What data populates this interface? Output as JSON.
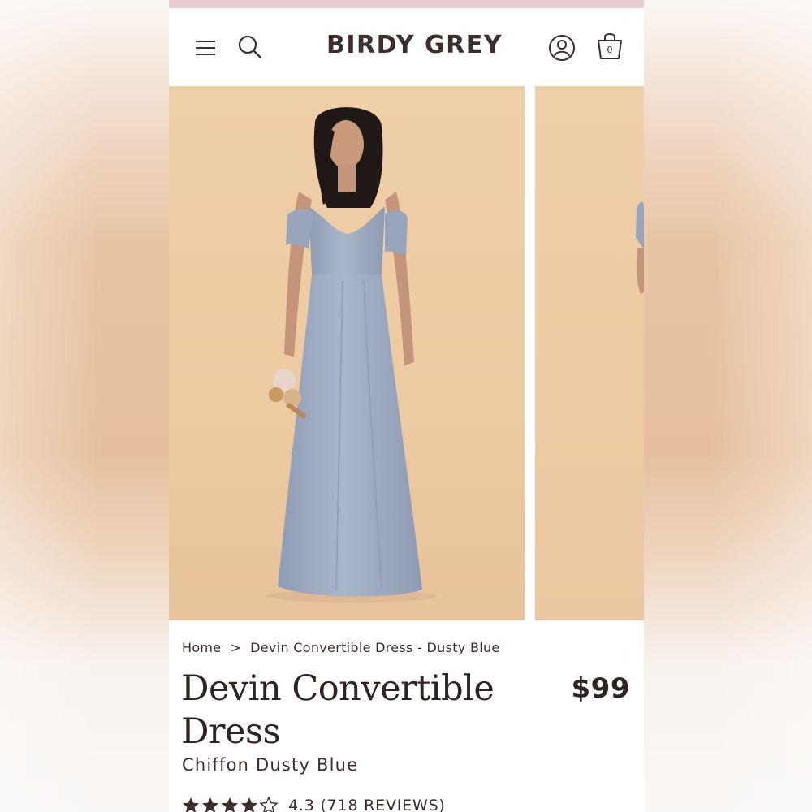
{
  "header": {
    "logo": "BIRDY GREY",
    "cart_count": "0",
    "icons": [
      "menu-icon",
      "search-icon",
      "account-icon",
      "shopping-bag-icon"
    ]
  },
  "gallery": {
    "slides": [
      "product-photo-front",
      "product-photo-next"
    ]
  },
  "breadcrumb": {
    "home": "Home",
    "separator": ">",
    "current": "Devin Convertible Dress - Dusty Blue"
  },
  "product": {
    "title": "Devin Convertible Dress",
    "price": "$99",
    "variant": "Chiffon Dusty Blue",
    "rating": 4.3,
    "rating_text": "4.3 (718 REVIEWS)"
  },
  "colors": {
    "promo_bar": "#e9cdd3",
    "text": "#3b2e2c",
    "photo_background": "#eccaa2",
    "dress": "#a3b0c6"
  }
}
